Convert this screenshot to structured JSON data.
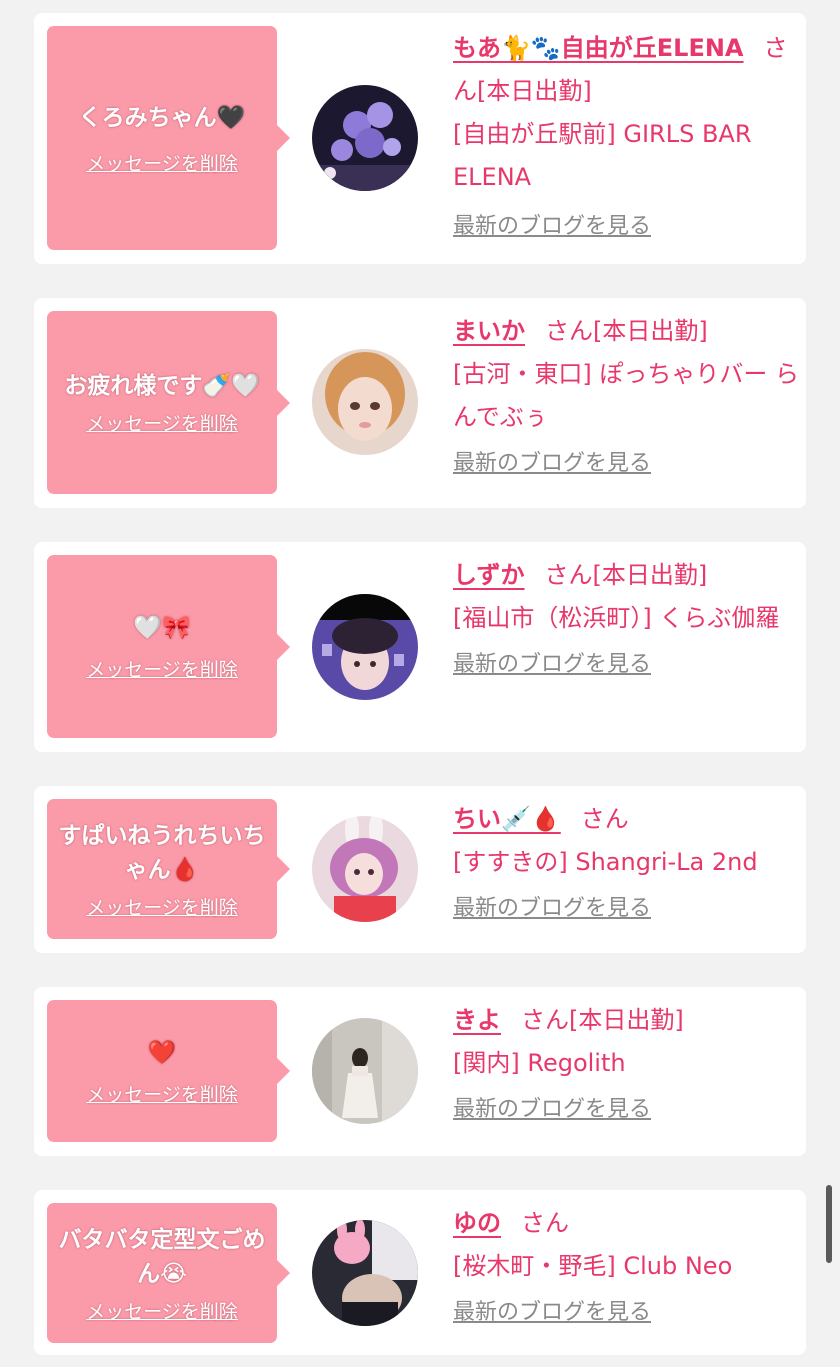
{
  "cards": [
    {
      "message": "くろみちゃん🖤",
      "delete_label": "メッセージを削除",
      "name": "もあ🐈🐾自由が丘ELENA",
      "san": "さん",
      "status": "[本日出勤]",
      "shop": "[自由が丘駅前] GIRLS BAR ELENA",
      "blog_label": "最新のブログを見る",
      "avatar_icon": "party-balloons-photo"
    },
    {
      "message": "お疲れ様です🍼🤍",
      "delete_label": "メッセージを削除",
      "name": "まいか",
      "san": "さん",
      "status": "[本日出勤]",
      "shop": "[古河・東口] ぽっちゃりバー らんでぶぅ",
      "blog_label": "最新のブログを見る",
      "avatar_icon": "portrait-photo"
    },
    {
      "message": "🤍🎀",
      "delete_label": "メッセージを削除",
      "name": "しずか",
      "san": "さん",
      "status": "[本日出勤]",
      "shop": "[福山市（松浜町）] くらぶ伽羅",
      "blog_label": "最新のブログを見る",
      "avatar_icon": "portrait-photo"
    },
    {
      "message": "すぱいねうれちいちゃん🩸",
      "delete_label": "メッセージを削除",
      "name": "ちい💉🩸",
      "san": "さん",
      "status": "",
      "shop": "[すすきの] Shangri-La 2nd",
      "blog_label": "最新のブログを見る",
      "avatar_icon": "bunny-costume-photo"
    },
    {
      "message": "❤️",
      "delete_label": "メッセージを削除",
      "name": "きよ",
      "san": "さん",
      "status": "[本日出勤]",
      "shop": "[関内] Regolith",
      "blog_label": "最新のブログを見る",
      "avatar_icon": "full-body-photo"
    },
    {
      "message": "バタバタ定型文ごめん😭",
      "delete_label": "メッセージを削除",
      "name": "ゆの",
      "san": "さん",
      "status": "",
      "shop": "[桜木町・野毛] Club Neo",
      "blog_label": "最新のブログを見る",
      "avatar_icon": "bunny-sticker-photo"
    }
  ],
  "colors": {
    "accent": "#e8386b",
    "bubble": "#fb9aa8",
    "background": "#f2f2f2",
    "link_gray": "#8a8a8a"
  }
}
